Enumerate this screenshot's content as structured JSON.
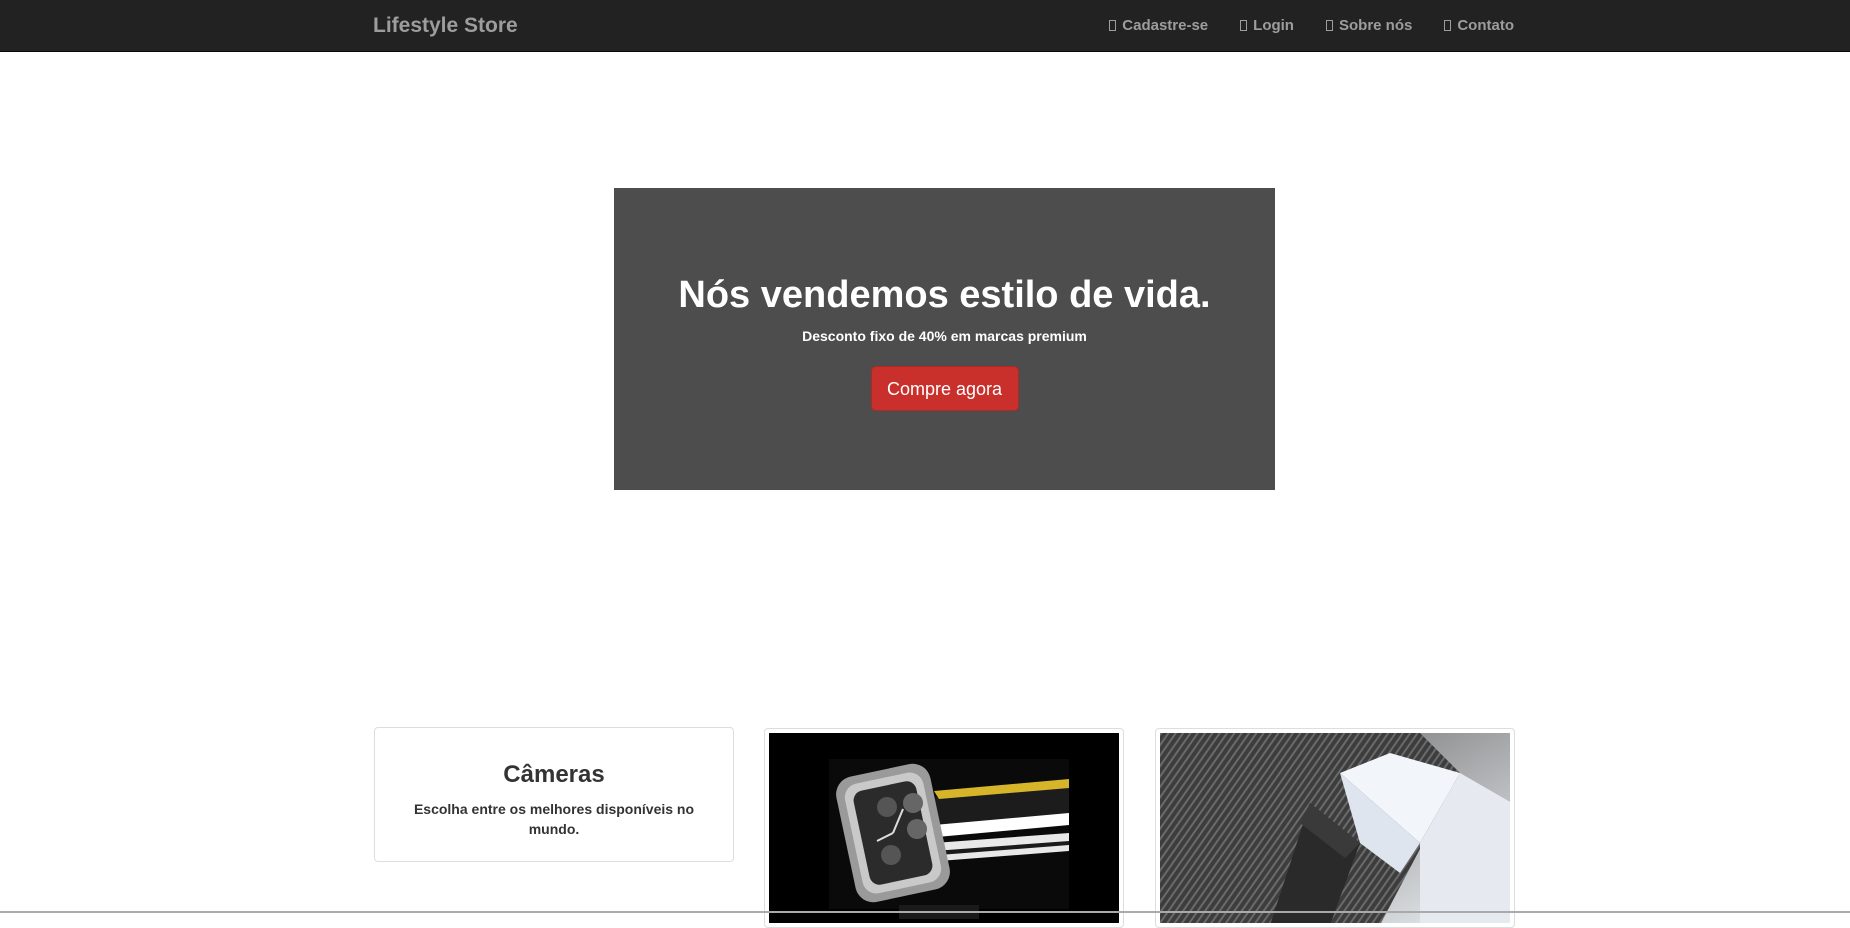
{
  "navbar": {
    "brand": "Lifestyle Store",
    "links": [
      {
        "label": "Cadastre-se",
        "icon": "user-icon"
      },
      {
        "label": "Login",
        "icon": "login-icon"
      },
      {
        "label": "Sobre nós",
        "icon": "info-icon"
      },
      {
        "label": "Contato",
        "icon": "phone-icon"
      }
    ]
  },
  "hero": {
    "title": "Nós vendemos estilo de vida.",
    "subtitle": "Desconto fixo de 40% em marcas premium",
    "button_label": "Compre agora"
  },
  "cards": {
    "cameras": {
      "title": "Câmeras",
      "description": "Escolha entre os melhores disponíveis no mundo."
    },
    "watches": {
      "image": "watch-image"
    },
    "shirts": {
      "image": "shirt-image"
    }
  },
  "colors": {
    "navbar": "#222222",
    "hero": "#4d4d4d",
    "cta": "#c9302c"
  }
}
